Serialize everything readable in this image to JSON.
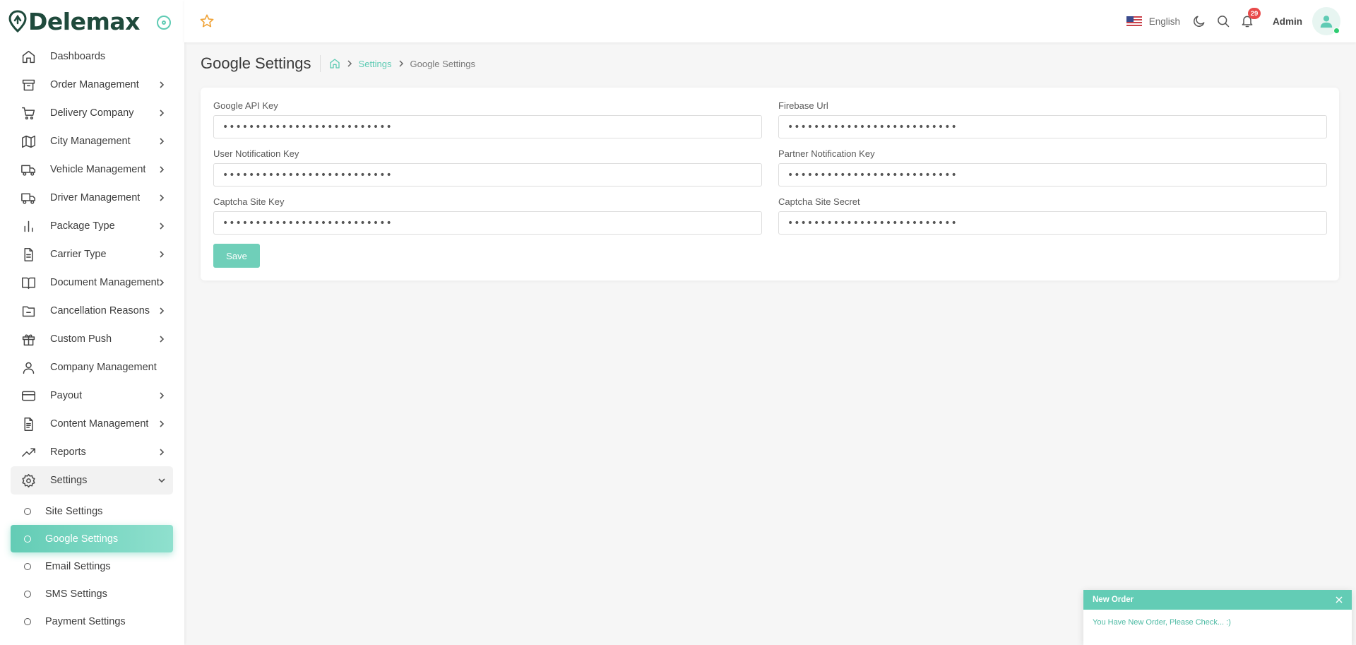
{
  "brand": {
    "name": "Delemax",
    "accent": "#5fcbb4"
  },
  "sidebar": {
    "items": [
      {
        "label": "Dashboards",
        "icon": "home-icon",
        "has_children": false
      },
      {
        "label": "Order Management",
        "icon": "archive-icon",
        "has_children": true
      },
      {
        "label": "Delivery Company",
        "icon": "cart-icon",
        "has_children": true
      },
      {
        "label": "City Management",
        "icon": "map-icon",
        "has_children": true
      },
      {
        "label": "Vehicle Management",
        "icon": "truck-icon",
        "has_children": true
      },
      {
        "label": "Driver Management",
        "icon": "truck-icon",
        "has_children": true
      },
      {
        "label": "Package Type",
        "icon": "bar-chart-icon",
        "has_children": true
      },
      {
        "label": "Carrier Type",
        "icon": "file-icon",
        "has_children": true
      },
      {
        "label": "Document Management",
        "icon": "book-icon",
        "has_children": true
      },
      {
        "label": "Cancellation Reasons",
        "icon": "folder-minus-icon",
        "has_children": true
      },
      {
        "label": "Custom Push",
        "icon": "gift-icon",
        "has_children": true
      },
      {
        "label": "Company Management",
        "icon": "user-icon",
        "has_children": false
      },
      {
        "label": "Payout",
        "icon": "credit-card-icon",
        "has_children": true
      },
      {
        "label": "Content Management",
        "icon": "file-text-icon",
        "has_children": true
      },
      {
        "label": "Reports",
        "icon": "trending-up-icon",
        "has_children": true
      },
      {
        "label": "Settings",
        "icon": "gear-icon",
        "has_children": true,
        "open": true
      }
    ],
    "settings_children": [
      {
        "label": "Site Settings",
        "active": false
      },
      {
        "label": "Google Settings",
        "active": true
      },
      {
        "label": "Email Settings",
        "active": false
      },
      {
        "label": "SMS Settings",
        "active": false
      },
      {
        "label": "Payment Settings",
        "active": false
      }
    ]
  },
  "header": {
    "language": "English",
    "notifications_count": "29",
    "user_name": "Admin"
  },
  "page": {
    "title": "Google Settings",
    "breadcrumb": {
      "parent": "Settings",
      "current": "Google Settings"
    }
  },
  "form": {
    "fields": [
      {
        "label": "Google API Key",
        "value": "••••••••••••••••••••••••••"
      },
      {
        "label": "Firebase Url",
        "value": "••••••••••••••••••••••••••"
      },
      {
        "label": "User Notification Key",
        "value": "••••••••••••••••••••••••••"
      },
      {
        "label": "Partner Notification Key",
        "value": "••••••••••••••••••••••••••"
      },
      {
        "label": "Captcha Site Key",
        "value": "••••••••••••••••••••••••••"
      },
      {
        "label": "Captcha Site Secret",
        "value": "••••••••••••••••••••••••••"
      }
    ],
    "save_label": "Save"
  },
  "toast": {
    "title": "New Order",
    "message": "You Have New Order, Please Check... :)"
  }
}
